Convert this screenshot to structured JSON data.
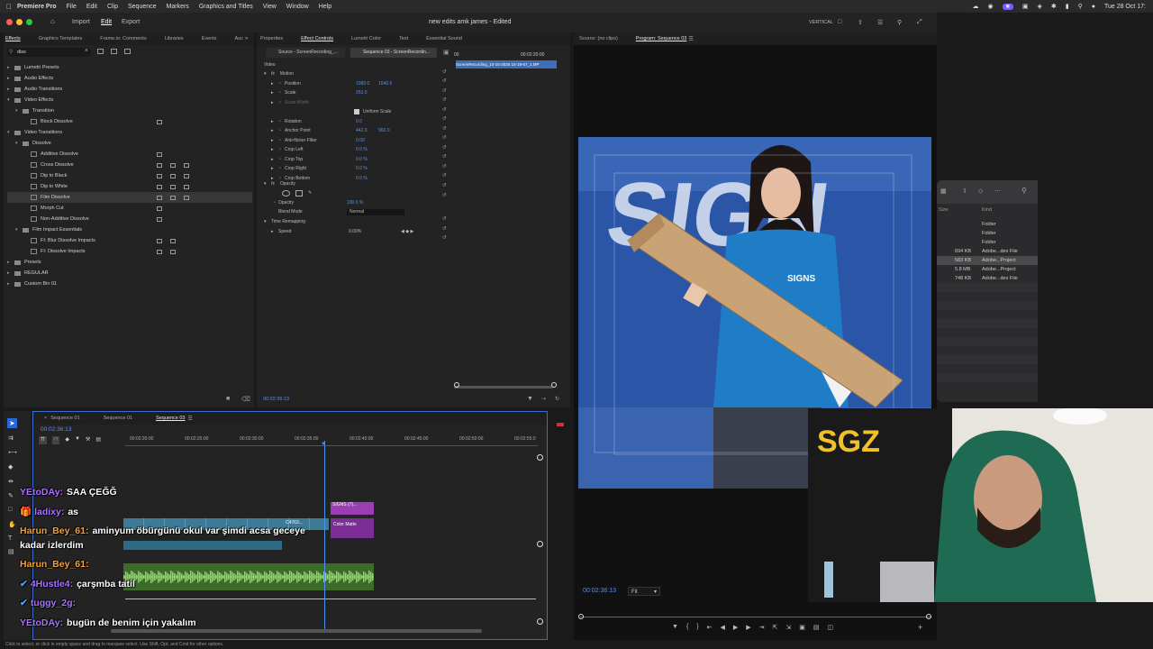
{
  "menubar": {
    "app": "Premiere Pro",
    "items": [
      "File",
      "Edit",
      "Clip",
      "Sequence",
      "Markers",
      "Graphics and Titles",
      "View",
      "Window",
      "Help"
    ],
    "clock": "Tue 28 Oct 17:"
  },
  "titlebar": {
    "workspaces": [
      "Import",
      "Edit",
      "Export"
    ],
    "title": "new edits amk james - Edited",
    "layout_label": "VERTICAL"
  },
  "effects_panel": {
    "tabs": [
      "Effects",
      "Graphics Templates",
      "Frame.io: Comments",
      "Libraries",
      "Events",
      "Auc"
    ],
    "search_value": "diss",
    "tree": [
      {
        "label": "Lumetri Presets",
        "level": 0,
        "open": false,
        "folder": true,
        "badges": 0
      },
      {
        "label": "Audio Effects",
        "level": 0,
        "open": false,
        "folder": true,
        "badges": 0
      },
      {
        "label": "Audio Transitions",
        "level": 0,
        "open": false,
        "folder": true,
        "badges": 0
      },
      {
        "label": "Video Effects",
        "level": 0,
        "open": true,
        "folder": true,
        "badges": 0
      },
      {
        "label": "Transition",
        "level": 1,
        "open": true,
        "folder": true,
        "badges": 0
      },
      {
        "label": "Block Dissolve",
        "level": 2,
        "open": null,
        "folder": false,
        "badges": 1
      },
      {
        "label": "Video Transitions",
        "level": 0,
        "open": true,
        "folder": true,
        "badges": 0
      },
      {
        "label": "Dissolve",
        "level": 1,
        "open": true,
        "folder": true,
        "badges": 0
      },
      {
        "label": "Additive Dissolve",
        "level": 2,
        "open": null,
        "folder": false,
        "badges": 1
      },
      {
        "label": "Cross Dissolve",
        "level": 2,
        "open": null,
        "folder": false,
        "badges": 3
      },
      {
        "label": "Dip to Black",
        "level": 2,
        "open": null,
        "folder": false,
        "badges": 3
      },
      {
        "label": "Dip to White",
        "level": 2,
        "open": null,
        "folder": false,
        "badges": 3
      },
      {
        "label": "Film Dissolve",
        "level": 2,
        "open": null,
        "folder": false,
        "badges": 3
      },
      {
        "label": "Morph Cut",
        "level": 2,
        "open": null,
        "folder": false,
        "badges": 1
      },
      {
        "label": "Non-Additive Dissolve",
        "level": 2,
        "open": null,
        "folder": false,
        "badges": 1
      },
      {
        "label": "Film Impact Essentials",
        "level": 1,
        "open": true,
        "folder": true,
        "badges": 0
      },
      {
        "label": "FI: Blur Dissolve Impacts",
        "level": 2,
        "open": null,
        "folder": false,
        "badges": 2
      },
      {
        "label": "FI: Dissolve Impacts",
        "level": 2,
        "open": null,
        "folder": false,
        "badges": 2
      },
      {
        "label": "Presets",
        "level": 0,
        "open": false,
        "folder": true,
        "badges": 0
      },
      {
        "label": "REGULAR",
        "level": 0,
        "open": false,
        "folder": true,
        "badges": 0
      },
      {
        "label": "Custom Bin 01",
        "level": 0,
        "open": false,
        "folder": true,
        "badges": 0
      }
    ]
  },
  "effect_controls": {
    "tabs": [
      "Properties",
      "Effect Controls",
      "Lumetri Color",
      "Text",
      "Essential Sound"
    ],
    "source_label": "Source - ScreenRecording_...",
    "sequence_label": "Sequence 03 - ScreenRecordin...",
    "section_video": "Video",
    "motion": "Motion",
    "rows": [
      {
        "label": "Position",
        "v1": "1080.0",
        "v2": "1040.6",
        "indent": 1
      },
      {
        "label": "Scale",
        "v1": "253.0",
        "v2": "",
        "indent": 1
      },
      {
        "label": "Scale Width",
        "v1": "",
        "v2": "",
        "indent": 1,
        "dim": true
      },
      {
        "label": "Uniform Scale",
        "v1": "",
        "v2": "",
        "indent": 2,
        "checkbox": true
      },
      {
        "label": "Rotation",
        "v1": "0.0",
        "v2": "",
        "indent": 1
      },
      {
        "label": "Anchor Point",
        "v1": "442.0",
        "v2": "960.0",
        "indent": 1
      },
      {
        "label": "Anti-flicker Filter",
        "v1": "0.00",
        "v2": "",
        "indent": 1
      },
      {
        "label": "Crop Left",
        "v1": "0.0 %",
        "v2": "",
        "indent": 1
      },
      {
        "label": "Crop Top",
        "v1": "0.0 %",
        "v2": "",
        "indent": 1
      },
      {
        "label": "Crop Right",
        "v1": "0.0 %",
        "v2": "",
        "indent": 1
      },
      {
        "label": "Crop Bottom",
        "v1": "0.0 %",
        "v2": "",
        "indent": 1
      }
    ],
    "opacity_section": "Opacity",
    "opacity_label": "Opacity",
    "opacity_value": "100.0 %",
    "blend_label": "Blend Mode",
    "blend_value": "Normal",
    "time_remap": "Time Remapping",
    "speed_label": "Speed",
    "speed_value": "0.00%",
    "mini_timecode": "00:02:20:00",
    "mini_start": "00",
    "clip_label": "ScreenRecording_10-15-2025 15-19-57_1.MP",
    "bottom_timecode": "00:02:36:13"
  },
  "program": {
    "source_tab": "Source: (no clips)",
    "program_tab": "Program: Sequence 03",
    "timecode": "00:02:36:13",
    "fit": "Fit"
  },
  "finder": {
    "columns": [
      "Size",
      "Kind"
    ],
    "rows": [
      {
        "size": "",
        "kind": "Folder"
      },
      {
        "size": "",
        "kind": "Folder"
      },
      {
        "size": "",
        "kind": "Folder"
      },
      {
        "size": "694 KB",
        "kind": "Adobe...dex File"
      },
      {
        "size": "583 KB",
        "kind": "Adobe...Project"
      },
      {
        "size": "5.8 MB",
        "kind": "Adobe...Project"
      },
      {
        "size": "748 KB",
        "kind": "Adobe...dex File"
      }
    ]
  },
  "timeline": {
    "tabs": [
      "Sequence 01",
      "Sequence 01",
      "Sequence 03"
    ],
    "timecode": "00:02:36:13",
    "ruler": [
      "00:02:20:00",
      "00:02:25:00",
      "00:02:30:00",
      "00:02:35:00",
      "00:02:40:00",
      "00:02:45:00",
      "00:02:50:00",
      "00:02:55:0"
    ],
    "clips": {
      "signs": "SIGNS (7)...",
      "color_matte": "Color Matte",
      "c4763": "C4763..."
    },
    "track_labels": [
      "V1",
      "A1",
      "A2"
    ]
  },
  "chat": [
    {
      "user": "YEtoDAy:",
      "msg": "SAA ÇEĞĞ",
      "color": "purple",
      "prefix": ""
    },
    {
      "user": "ladixy:",
      "msg": "as",
      "color": "purple",
      "prefix": "🎁"
    },
    {
      "user": "Harun_Bey_61:",
      "msg": "aminyum öbürgünü okul var şimdi acsa geceye",
      "color": "orange",
      "prefix": ""
    },
    {
      "user": "",
      "msg": "kadar izlerdim",
      "color": "orange",
      "prefix": ""
    },
    {
      "user": "Harun_Bey_61:",
      "msg": "",
      "color": "orange",
      "prefix": ""
    },
    {
      "user": "4Hustle4:",
      "msg": "çarşmba tatil",
      "color": "purple",
      "prefix": "✔"
    },
    {
      "user": "tuggy_2g:",
      "msg": "",
      "color": "purple",
      "prefix": "✔"
    },
    {
      "user": "YEtoDAy:",
      "msg": "bugün de benim için yakalım",
      "color": "purple",
      "prefix": ""
    }
  ],
  "status_bar": "Click to select, or click in empty space and drag to marquee select. Use Shift, Opt, and Cmd for other options.",
  "video": {
    "sign_text": "SIGN",
    "shirt_text": "SIGNS",
    "webcam_text": "SGZ"
  }
}
